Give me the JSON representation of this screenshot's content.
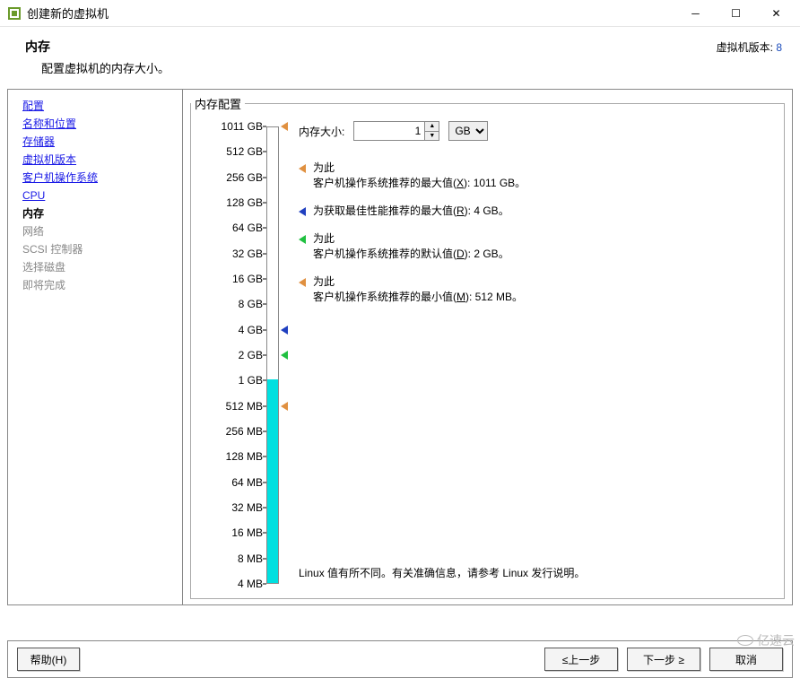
{
  "window": {
    "title": "创建新的虚拟机",
    "version_label": "虚拟机版本:",
    "version_value": "8"
  },
  "header": {
    "title": "内存",
    "subtitle": "配置虚拟机的内存大小。"
  },
  "sidebar": {
    "items": [
      {
        "label": "配置",
        "state": "link"
      },
      {
        "label": "名称和位置",
        "state": "link"
      },
      {
        "label": "存储器",
        "state": "link"
      },
      {
        "label": "虚拟机版本",
        "state": "link"
      },
      {
        "label": "客户机操作系统",
        "state": "link"
      },
      {
        "label": "CPU",
        "state": "link"
      },
      {
        "label": "内存",
        "state": "current"
      },
      {
        "label": "网络",
        "state": "disabled"
      },
      {
        "label": "SCSI 控制器",
        "state": "disabled"
      },
      {
        "label": "选择磁盘",
        "state": "disabled"
      },
      {
        "label": "即将完成",
        "state": "disabled"
      }
    ]
  },
  "memory": {
    "group_title": "内存配置",
    "size_label": "内存大小:",
    "size_value": "1",
    "unit": "GB",
    "ticks": [
      "1011 GB",
      "512 GB",
      "256 GB",
      "128 GB",
      "64 GB",
      "32 GB",
      "16 GB",
      "8 GB",
      "4 GB",
      "2 GB",
      "1 GB",
      "512 MB",
      "256 MB",
      "128 MB",
      "64 MB",
      "32 MB",
      "16 MB",
      "8 MB",
      "4 MB"
    ],
    "current_value_gb": 1,
    "recommendations": [
      {
        "color": "orange",
        "pre": "为此",
        "text": "客户机操作系统推荐的最大值",
        "hotkey": "X",
        "value": "1011 GB",
        "slider_at": "1011 GB"
      },
      {
        "color": "blue",
        "pre": "",
        "text": "为获取最佳性能推荐的最大值",
        "hotkey": "R",
        "value": "4 GB",
        "slider_at": "4 GB"
      },
      {
        "color": "green",
        "pre": "为此",
        "text": "客户机操作系统推荐的默认值",
        "hotkey": "D",
        "value": "2 GB",
        "slider_at": "2 GB"
      },
      {
        "color": "orange",
        "pre": "为此",
        "text": "客户机操作系统推荐的最小值",
        "hotkey": "M",
        "value": "512 MB",
        "slider_at": "512 MB"
      }
    ],
    "footnote": "Linux 值有所不同。有关准确信息，请参考 Linux 发行说明。"
  },
  "buttons": {
    "help": "帮助(H)",
    "back": "≤上一步",
    "next": "下一步 ≥",
    "cancel": "取消"
  },
  "watermark": "亿速云"
}
